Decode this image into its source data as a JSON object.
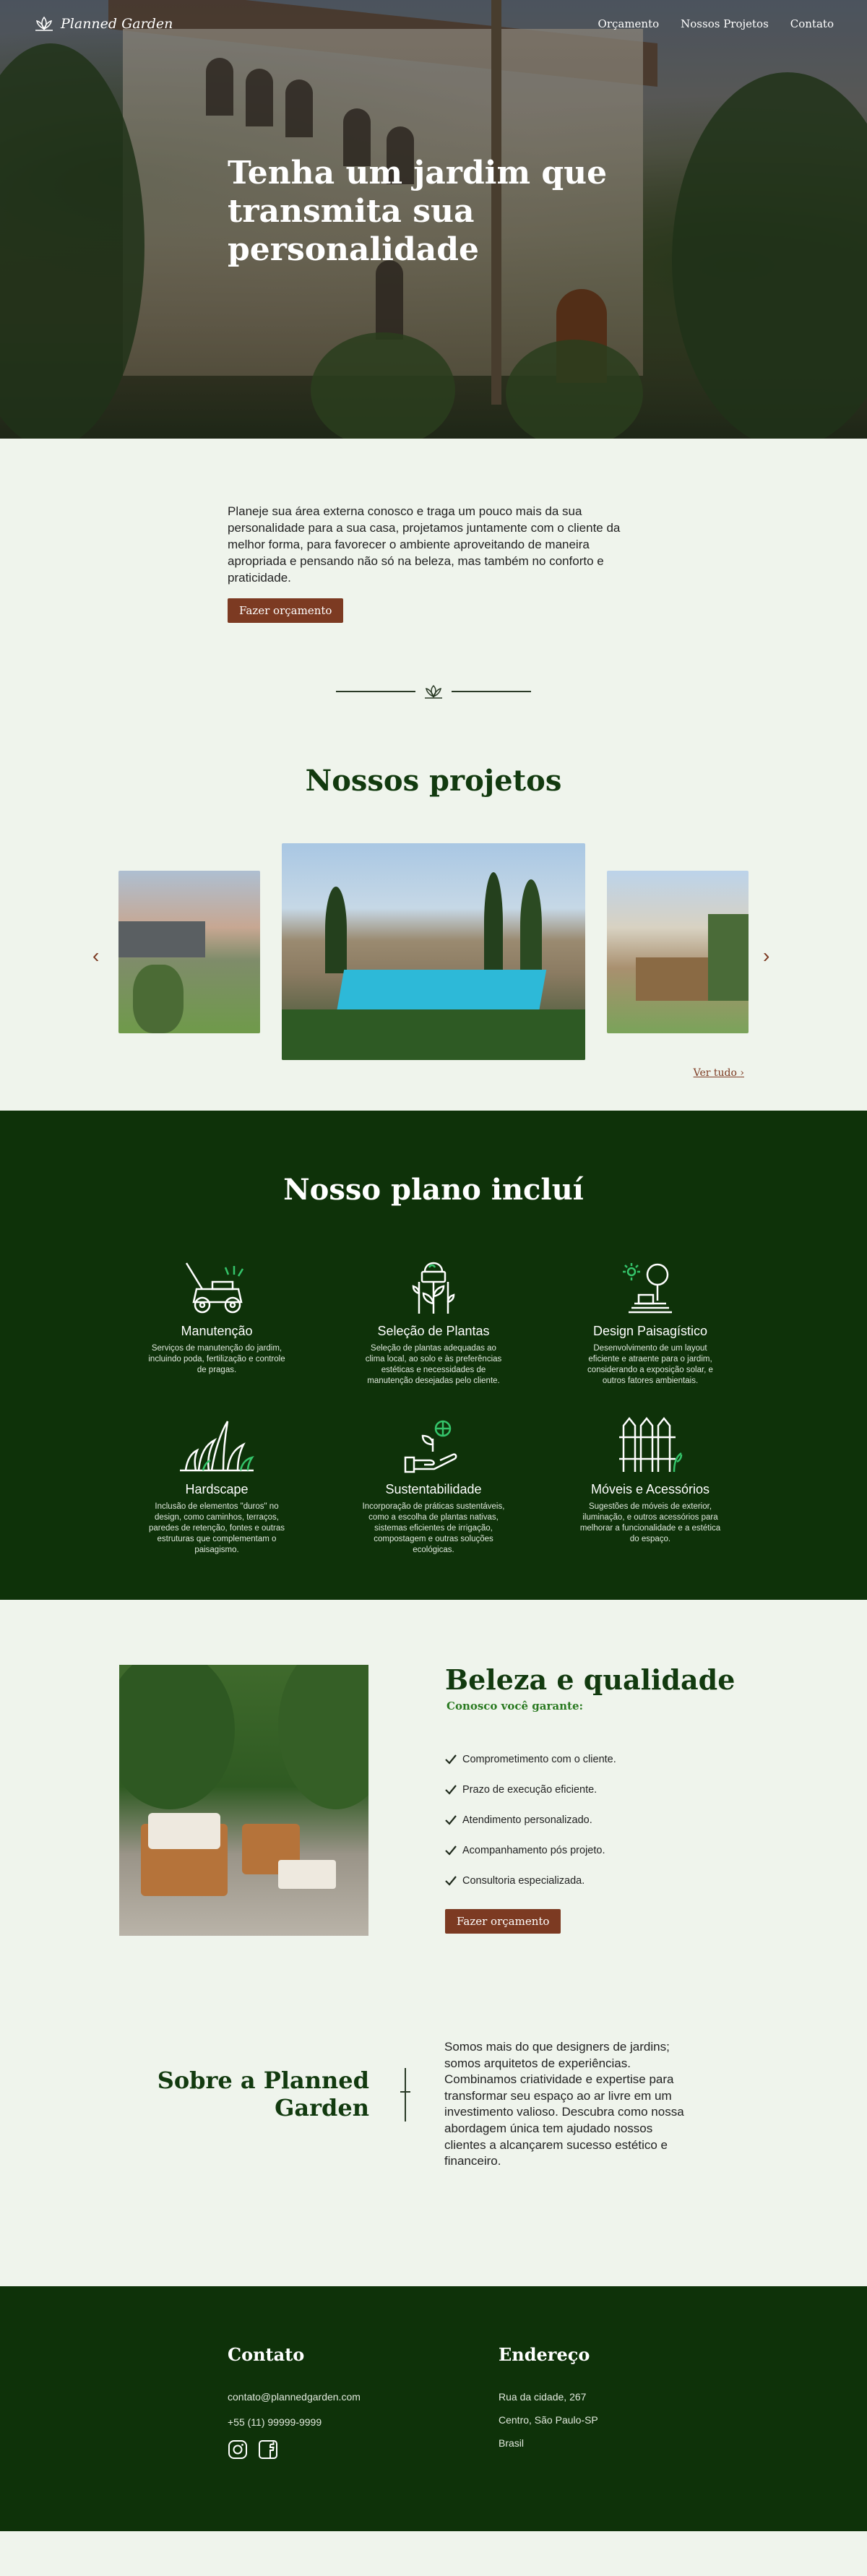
{
  "nav": {
    "logo_text": "Planned Garden",
    "links": [
      "Orçamento",
      "Nossos Projetos",
      "Contato"
    ]
  },
  "hero": {
    "title": "Tenha um jardim que transmita sua personalidade"
  },
  "intro": {
    "text": "Planeje sua área externa conosco e traga um pouco mais da sua personalidade para a sua casa, projetamos juntamente com o cliente da melhor forma, para favorecer o ambiente aproveitando de maneira apropriada e pensando não só na beleza, mas também no conforto e praticidade.",
    "button": "Fazer orçamento"
  },
  "projects": {
    "title": "Nossos projetos",
    "prev": "‹",
    "next": "›",
    "see_all": "Ver tudo"
  },
  "plan": {
    "title": "Nosso plano incluí",
    "items": [
      {
        "title": "Manutenção",
        "text": "Serviços de manutenção do jardim, incluindo poda, fertilização e controle de pragas.",
        "icon": "lawnmower-icon"
      },
      {
        "title": "Seleção de Plantas",
        "text": "Seleção de plantas adequadas ao clima local, ao solo e às preferências estéticas e necessidades de manutenção desejadas pelo cliente.",
        "icon": "plant-selection-icon"
      },
      {
        "title": "Design Paisagístico",
        "text": "Desenvolvimento de um layout eficiente e atraente para o jardim, considerando a exposição solar, e outros fatores ambientais.",
        "icon": "landscape-design-icon"
      },
      {
        "title": "Hardscape",
        "text": "Inclusão de elementos \"duros\" no design, como caminhos, terraços, paredes de retenção, fontes e outras estruturas que complementam o paisagismo.",
        "icon": "grass-icon"
      },
      {
        "title": "Sustentabilidade",
        "text": "Incorporação de práticas sustentáveis, como a escolha de plantas nativas, sistemas eficientes de irrigação, compostagem e outras soluções ecológicas.",
        "icon": "sustainability-icon"
      },
      {
        "title": "Móveis e Acessórios",
        "text": "Sugestões de móveis de exterior, iluminação, e outros acessórios para melhorar a funcionalidade e a estética do espaço.",
        "icon": "fence-icon"
      }
    ]
  },
  "quality": {
    "title": "Beleza e qualidade",
    "subtitle": "Conosco você garante:",
    "checks": [
      "Comprometimento com o cliente.",
      "Prazo de execução eficiente.",
      "Atendimento personalizado.",
      "Acompanhamento pós projeto.",
      "Consultoria especializada."
    ],
    "button": "Fazer orçamento"
  },
  "about": {
    "title": "Sobre a Planned Garden",
    "text": "Somos mais do que designers de jardins; somos arquitetos de experiências. Combinamos criatividade e expertise para transformar seu espaço ao ar livre em um investimento valioso. Descubra como nossa abordagem única tem ajudado nossos clientes a alcançarem sucesso estético e financeiro."
  },
  "footer": {
    "contact_title": "Contato",
    "email": "contato@plannedgarden.com",
    "phone": "+55 (11) 99999-9999",
    "address_title": "Endereço",
    "address_lines": [
      "Rua da cidade, 267",
      "Centro, São Paulo-SP",
      "Brasil"
    ]
  },
  "colors": {
    "accent": "#7c3a22",
    "dark_green": "#0e3209",
    "title_green": "#123a0f",
    "background": "#eff4ec"
  }
}
